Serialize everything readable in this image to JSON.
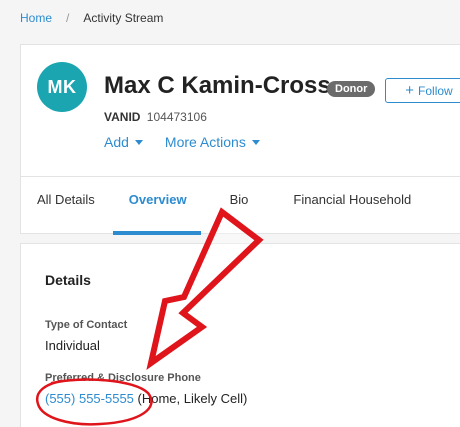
{
  "breadcrumb": {
    "home": "Home",
    "separator": "/",
    "current": "Activity Stream"
  },
  "profile": {
    "initials": "MK",
    "name": "Max C Kamin-Cross",
    "badge": "Donor",
    "follow_label": "Follow",
    "vanid_label": "VANID",
    "vanid_value": "104473106",
    "add_label": "Add",
    "more_actions_label": "More Actions"
  },
  "tabs": [
    {
      "label": "All Details"
    },
    {
      "label": "Overview",
      "active": true
    },
    {
      "label": "Bio"
    },
    {
      "label": "Financial Household"
    }
  ],
  "details": {
    "title": "Details",
    "type_of_contact_label": "Type of Contact",
    "type_of_contact_value": "Individual",
    "phone_label": "Preferred & Disclosure Phone",
    "phone_number": "(555) 555-5555",
    "phone_note": "(Home, Likely Cell)"
  },
  "colors": {
    "accent": "#2d8ccf",
    "avatar": "#1aa5b0",
    "annotation": "#e0141b"
  }
}
